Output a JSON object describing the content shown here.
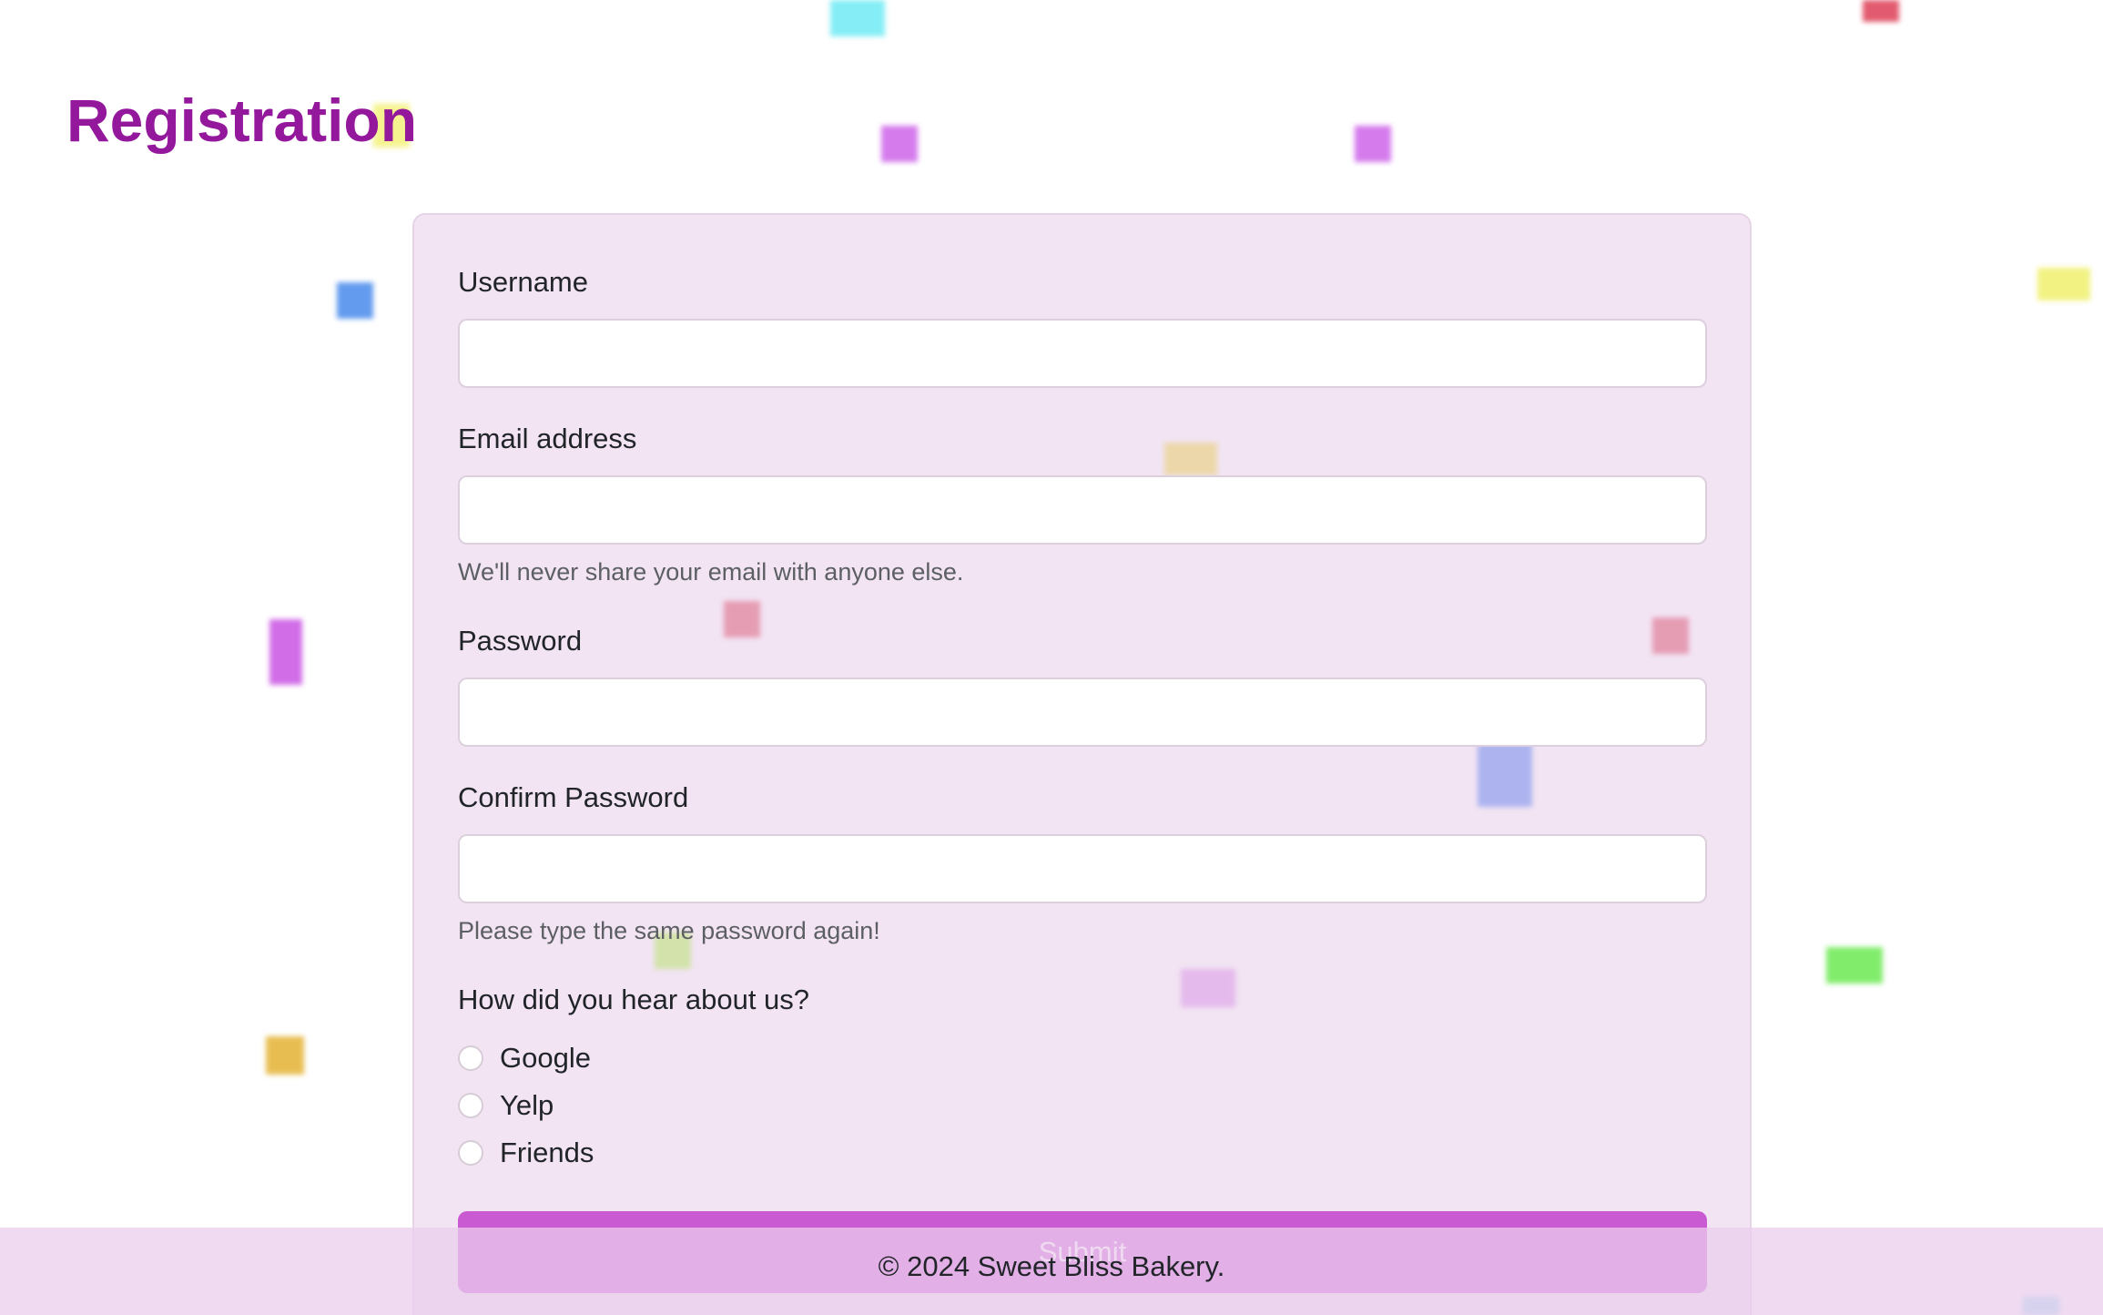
{
  "page": {
    "title": "Registration"
  },
  "form": {
    "username": {
      "label": "Username",
      "value": "",
      "placeholder": ""
    },
    "email": {
      "label": "Email address",
      "value": "",
      "placeholder": "",
      "help": "We'll never share your email with anyone else."
    },
    "password": {
      "label": "Password",
      "value": "",
      "placeholder": ""
    },
    "confirm_password": {
      "label": "Confirm Password",
      "value": "",
      "placeholder": "",
      "help": "Please type the same password again!"
    },
    "referral": {
      "question": "How did you hear about us?",
      "options": [
        "Google",
        "Yelp",
        "Friends"
      ]
    },
    "submit_label": "Submit"
  },
  "footer": {
    "text": "© 2024 Sweet Bliss Bakery."
  },
  "colors": {
    "title": "#94189c",
    "card_background": "#f2e4f3",
    "submit_button": "#c95ad1",
    "footer_background": "#e9cdec"
  }
}
